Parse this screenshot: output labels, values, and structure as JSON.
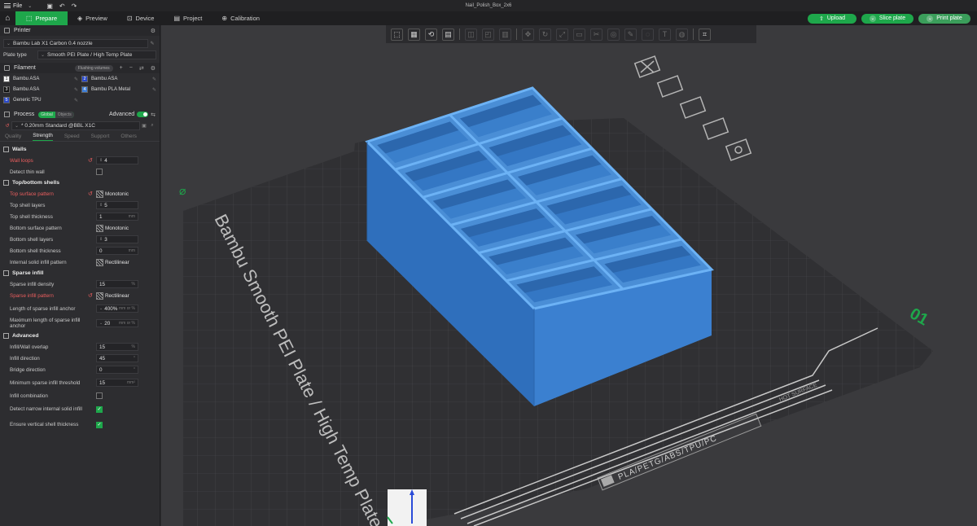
{
  "window": {
    "menu_label": "File",
    "title": "Nail_Polish_Box_2x6"
  },
  "toolbar": {
    "tabs": [
      {
        "label": "Prepare",
        "icon": "cube-icon"
      },
      {
        "label": "Preview",
        "icon": "preview-icon"
      },
      {
        "label": "Device",
        "icon": "device-icon"
      },
      {
        "label": "Project",
        "icon": "project-icon"
      },
      {
        "label": "Calibration",
        "icon": "calibration-icon"
      }
    ],
    "upload_label": "Upload",
    "slice_label": "Slice plate",
    "print_label": "Print plate"
  },
  "sidebar": {
    "printer": {
      "header": "Printer",
      "printer_name": "Bambu Lab X1 Carbon 0.4 nozzle",
      "plate_type_label": "Plate type",
      "plate_type_value": "Smooth PEI Plate / High Temp Plate"
    },
    "filament": {
      "header": "Filament",
      "flushing_label": "Flushing volumes",
      "items": [
        {
          "num": "1",
          "name": "Bambu ASA",
          "color": "#f5f5f5",
          "numcolor": "#222"
        },
        {
          "num": "2",
          "name": "Bambu ASA",
          "color": "#2a49c9",
          "numcolor": "#fff"
        },
        {
          "num": "3",
          "name": "Bambu ASA",
          "color": "#111111",
          "numcolor": "#fff"
        },
        {
          "num": "4",
          "name": "Bambu PLA Metal",
          "color": "#3f7fd8",
          "numcolor": "#fff"
        },
        {
          "num": "5",
          "name": "Generic TPU",
          "color": "#2a49c9",
          "numcolor": "#fff"
        }
      ]
    },
    "process": {
      "header": "Process",
      "global_label": "Global",
      "objects_label": "Objects",
      "advanced_label": "Advanced",
      "preset": "* 0.20mm Standard @BBL X1C",
      "tabs": [
        "Quality",
        "Strength",
        "Speed",
        "Support",
        "Others"
      ],
      "active_tab": "Strength"
    },
    "walls": {
      "title": "Walls",
      "wall_loops_label": "Wall loops",
      "wall_loops_value": "4",
      "detect_thin_label": "Detect thin wall"
    },
    "shells": {
      "title": "Top/bottom shells",
      "top_pattern_label": "Top surface pattern",
      "top_pattern_value": "Monotonic",
      "top_layers_label": "Top shell layers",
      "top_layers_value": "5",
      "top_thickness_label": "Top shell thickness",
      "top_thickness_value": "1",
      "bottom_pattern_label": "Bottom surface pattern",
      "bottom_pattern_value": "Monotonic",
      "bottom_layers_label": "Bottom shell layers",
      "bottom_layers_value": "3",
      "bottom_thickness_label": "Bottom shell thickness",
      "bottom_thickness_value": "0",
      "internal_pattern_label": "Internal solid infill pattern",
      "internal_pattern_value": "Rectilinear",
      "unit_mm": "mm"
    },
    "sparse": {
      "title": "Sparse infill",
      "density_label": "Sparse infill density",
      "density_value": "15",
      "density_unit": "%",
      "pattern_label": "Sparse infill pattern",
      "pattern_value": "Rectilinear",
      "anchor_label": "Length of sparse infill anchor",
      "anchor_value": "400%",
      "anchor_unit": "mm or %",
      "max_anchor_label": "Maximum length of sparse infill anchor",
      "max_anchor_value": "20",
      "max_anchor_unit": "mm or %"
    },
    "advanced": {
      "title": "Advanced",
      "overlap_label": "Infill/Wall overlap",
      "overlap_value": "15",
      "overlap_unit": "%",
      "direction_label": "Infill direction",
      "direction_value": "45",
      "direction_unit": "°",
      "bridge_label": "Bridge direction",
      "bridge_value": "0",
      "bridge_unit": "°",
      "min_sparse_label": "Minimum sparse infill threshold",
      "min_sparse_value": "15",
      "min_sparse_unit": "mm²",
      "combination_label": "Infill combination",
      "narrow_label": "Detect narrow internal solid infill",
      "vertical_label": "Ensure vertical shell thickness"
    }
  },
  "viewport": {
    "plate_label": "Bambu Smooth PEI Plate / High Temp Plate",
    "plate_number": "01",
    "material_strip": "PLA/PETG/ABS/TPU/PC",
    "hot_surface": "HOT SURFACE",
    "model_color": "#3b87d6",
    "model_edge_color": "#6cb2f5"
  }
}
